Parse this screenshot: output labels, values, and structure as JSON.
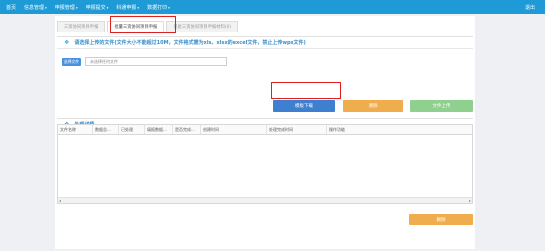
{
  "nav": {
    "items": [
      {
        "label": "首页",
        "caret": ""
      },
      {
        "label": "信息管理",
        "caret": "▾"
      },
      {
        "label": "申报管理",
        "caret": "▾"
      },
      {
        "label": "申报提交",
        "caret": "▾"
      },
      {
        "label": "科通申报",
        "caret": "▾"
      },
      {
        "label": "数据打印",
        "caret": "▾"
      }
    ],
    "exit_label": "退出"
  },
  "tabs": [
    {
      "label": "三资协同项目申报"
    },
    {
      "label": "批量三资协同项目申报"
    },
    {
      "label": "已批三资协同项目申报材料(0)"
    }
  ],
  "upload_section": {
    "title": "请选择上传的文件(文件大小不能超过10M，文件格式需为xls、xlsx的excel文件，禁止上传wps文件)",
    "choose_label": "选择文件",
    "file_placeholder": "未选择任何文件"
  },
  "actions": {
    "template_label": "模板下载",
    "clear_label": "清除",
    "upload_label": "文件上传"
  },
  "result_section": {
    "title": "处理详情"
  },
  "table": {
    "columns": [
      "文件名称",
      "数据总...",
      "已处理",
      "填报数据...",
      "是否完成...",
      "创建时间",
      "处理完成时间",
      "操作功能"
    ]
  },
  "delete_label": "删除",
  "colors": {
    "navbar": "#1e9ad6",
    "primary": "#3f7fd0",
    "warning": "#f0ad4e",
    "success_light": "#8fd08f",
    "highlight_frame": "#e02020"
  }
}
